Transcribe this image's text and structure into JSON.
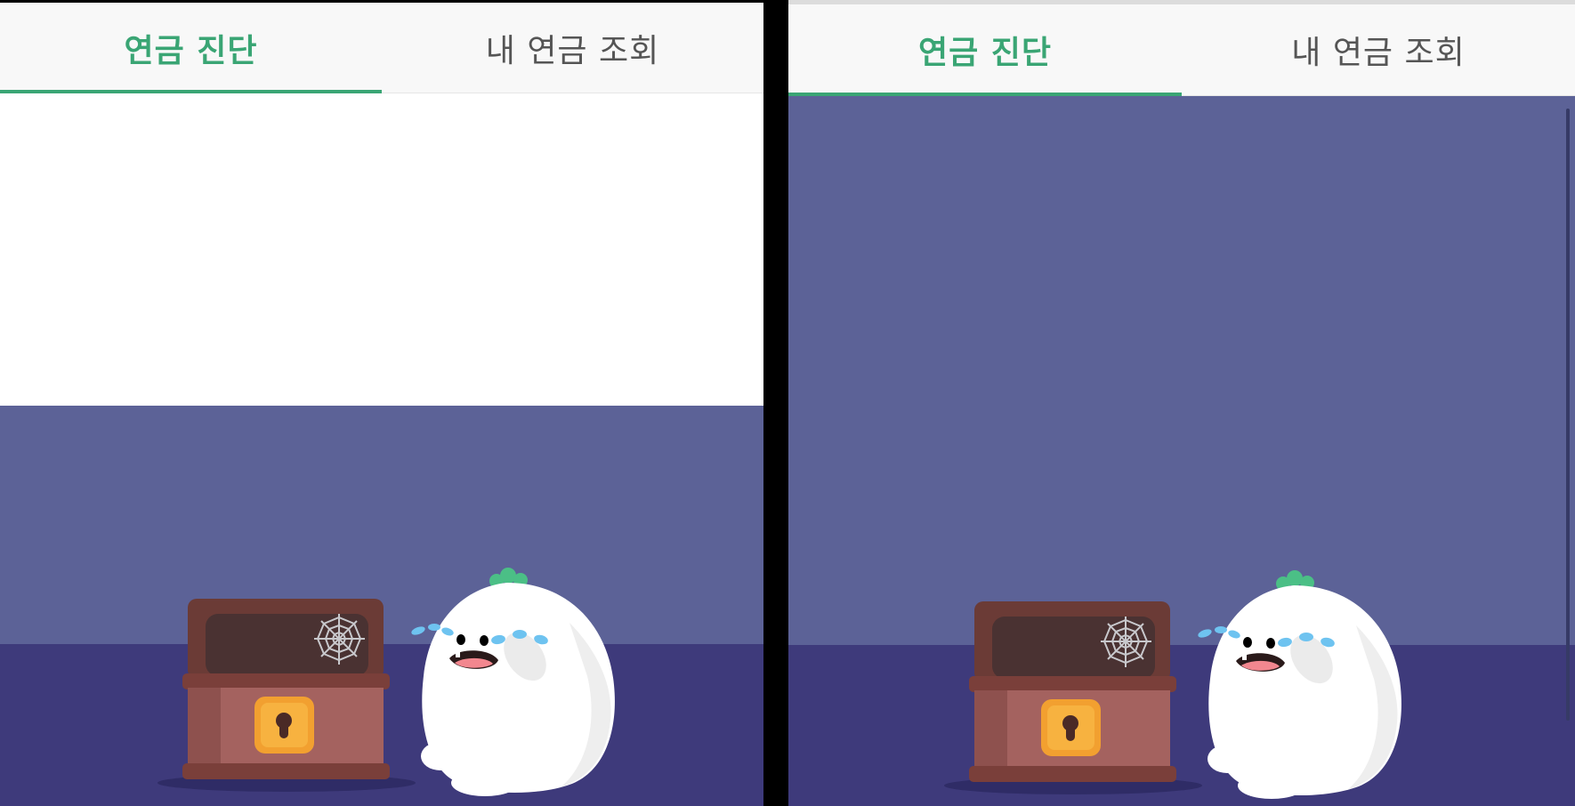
{
  "screens": [
    {
      "tabs": [
        {
          "label": "연금 진단",
          "active": true
        },
        {
          "label": "내 연금 조회",
          "active": false
        }
      ]
    },
    {
      "tabs": [
        {
          "label": "연금 진단",
          "active": true
        },
        {
          "label": "내 연금 조회",
          "active": false
        }
      ]
    }
  ],
  "illustration": {
    "items": [
      "treasure-chest",
      "spider-web",
      "keyhole",
      "crying-radish-character",
      "tears"
    ]
  },
  "colors": {
    "accent_green": "#3aa574",
    "wall": "#5c6297",
    "floor": "#3e3a7b",
    "chest_dark": "#6b3b36",
    "chest_body": "#a4625f",
    "lock": "#f2a030"
  }
}
